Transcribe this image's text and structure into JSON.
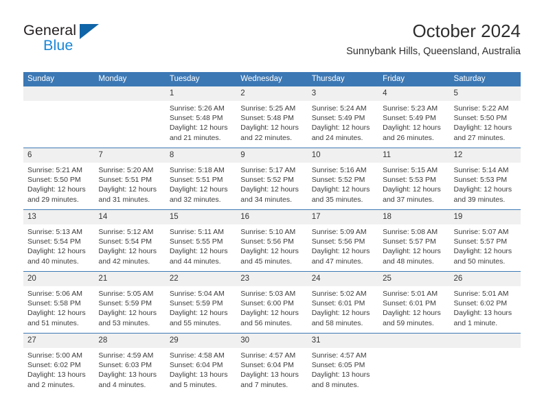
{
  "brand": {
    "name_part1": "General",
    "name_part2": "Blue",
    "triangle_color": "#1064a8",
    "blue_text_color": "#1787d8"
  },
  "header": {
    "title": "October 2024",
    "subtitle": "Sunnybank Hills, Queensland, Australia"
  },
  "theme": {
    "header_blue": "#3c78b4",
    "day_number_bg": "#f0f0f0",
    "cell_bg": "#ffffff"
  },
  "weekdays": [
    "Sunday",
    "Monday",
    "Tuesday",
    "Wednesday",
    "Thursday",
    "Friday",
    "Saturday"
  ],
  "weeks": [
    [
      {
        "day": "",
        "sunrise": "",
        "sunset": "",
        "daylight_line1": "",
        "daylight_line2": ""
      },
      {
        "day": "",
        "sunrise": "",
        "sunset": "",
        "daylight_line1": "",
        "daylight_line2": ""
      },
      {
        "day": "1",
        "sunrise": "Sunrise: 5:26 AM",
        "sunset": "Sunset: 5:48 PM",
        "daylight_line1": "Daylight: 12 hours",
        "daylight_line2": "and 21 minutes."
      },
      {
        "day": "2",
        "sunrise": "Sunrise: 5:25 AM",
        "sunset": "Sunset: 5:48 PM",
        "daylight_line1": "Daylight: 12 hours",
        "daylight_line2": "and 22 minutes."
      },
      {
        "day": "3",
        "sunrise": "Sunrise: 5:24 AM",
        "sunset": "Sunset: 5:49 PM",
        "daylight_line1": "Daylight: 12 hours",
        "daylight_line2": "and 24 minutes."
      },
      {
        "day": "4",
        "sunrise": "Sunrise: 5:23 AM",
        "sunset": "Sunset: 5:49 PM",
        "daylight_line1": "Daylight: 12 hours",
        "daylight_line2": "and 26 minutes."
      },
      {
        "day": "5",
        "sunrise": "Sunrise: 5:22 AM",
        "sunset": "Sunset: 5:50 PM",
        "daylight_line1": "Daylight: 12 hours",
        "daylight_line2": "and 27 minutes."
      }
    ],
    [
      {
        "day": "6",
        "sunrise": "Sunrise: 5:21 AM",
        "sunset": "Sunset: 5:50 PM",
        "daylight_line1": "Daylight: 12 hours",
        "daylight_line2": "and 29 minutes."
      },
      {
        "day": "7",
        "sunrise": "Sunrise: 5:20 AM",
        "sunset": "Sunset: 5:51 PM",
        "daylight_line1": "Daylight: 12 hours",
        "daylight_line2": "and 31 minutes."
      },
      {
        "day": "8",
        "sunrise": "Sunrise: 5:18 AM",
        "sunset": "Sunset: 5:51 PM",
        "daylight_line1": "Daylight: 12 hours",
        "daylight_line2": "and 32 minutes."
      },
      {
        "day": "9",
        "sunrise": "Sunrise: 5:17 AM",
        "sunset": "Sunset: 5:52 PM",
        "daylight_line1": "Daylight: 12 hours",
        "daylight_line2": "and 34 minutes."
      },
      {
        "day": "10",
        "sunrise": "Sunrise: 5:16 AM",
        "sunset": "Sunset: 5:52 PM",
        "daylight_line1": "Daylight: 12 hours",
        "daylight_line2": "and 35 minutes."
      },
      {
        "day": "11",
        "sunrise": "Sunrise: 5:15 AM",
        "sunset": "Sunset: 5:53 PM",
        "daylight_line1": "Daylight: 12 hours",
        "daylight_line2": "and 37 minutes."
      },
      {
        "day": "12",
        "sunrise": "Sunrise: 5:14 AM",
        "sunset": "Sunset: 5:53 PM",
        "daylight_line1": "Daylight: 12 hours",
        "daylight_line2": "and 39 minutes."
      }
    ],
    [
      {
        "day": "13",
        "sunrise": "Sunrise: 5:13 AM",
        "sunset": "Sunset: 5:54 PM",
        "daylight_line1": "Daylight: 12 hours",
        "daylight_line2": "and 40 minutes."
      },
      {
        "day": "14",
        "sunrise": "Sunrise: 5:12 AM",
        "sunset": "Sunset: 5:54 PM",
        "daylight_line1": "Daylight: 12 hours",
        "daylight_line2": "and 42 minutes."
      },
      {
        "day": "15",
        "sunrise": "Sunrise: 5:11 AM",
        "sunset": "Sunset: 5:55 PM",
        "daylight_line1": "Daylight: 12 hours",
        "daylight_line2": "and 44 minutes."
      },
      {
        "day": "16",
        "sunrise": "Sunrise: 5:10 AM",
        "sunset": "Sunset: 5:56 PM",
        "daylight_line1": "Daylight: 12 hours",
        "daylight_line2": "and 45 minutes."
      },
      {
        "day": "17",
        "sunrise": "Sunrise: 5:09 AM",
        "sunset": "Sunset: 5:56 PM",
        "daylight_line1": "Daylight: 12 hours",
        "daylight_line2": "and 47 minutes."
      },
      {
        "day": "18",
        "sunrise": "Sunrise: 5:08 AM",
        "sunset": "Sunset: 5:57 PM",
        "daylight_line1": "Daylight: 12 hours",
        "daylight_line2": "and 48 minutes."
      },
      {
        "day": "19",
        "sunrise": "Sunrise: 5:07 AM",
        "sunset": "Sunset: 5:57 PM",
        "daylight_line1": "Daylight: 12 hours",
        "daylight_line2": "and 50 minutes."
      }
    ],
    [
      {
        "day": "20",
        "sunrise": "Sunrise: 5:06 AM",
        "sunset": "Sunset: 5:58 PM",
        "daylight_line1": "Daylight: 12 hours",
        "daylight_line2": "and 51 minutes."
      },
      {
        "day": "21",
        "sunrise": "Sunrise: 5:05 AM",
        "sunset": "Sunset: 5:59 PM",
        "daylight_line1": "Daylight: 12 hours",
        "daylight_line2": "and 53 minutes."
      },
      {
        "day": "22",
        "sunrise": "Sunrise: 5:04 AM",
        "sunset": "Sunset: 5:59 PM",
        "daylight_line1": "Daylight: 12 hours",
        "daylight_line2": "and 55 minutes."
      },
      {
        "day": "23",
        "sunrise": "Sunrise: 5:03 AM",
        "sunset": "Sunset: 6:00 PM",
        "daylight_line1": "Daylight: 12 hours",
        "daylight_line2": "and 56 minutes."
      },
      {
        "day": "24",
        "sunrise": "Sunrise: 5:02 AM",
        "sunset": "Sunset: 6:01 PM",
        "daylight_line1": "Daylight: 12 hours",
        "daylight_line2": "and 58 minutes."
      },
      {
        "day": "25",
        "sunrise": "Sunrise: 5:01 AM",
        "sunset": "Sunset: 6:01 PM",
        "daylight_line1": "Daylight: 12 hours",
        "daylight_line2": "and 59 minutes."
      },
      {
        "day": "26",
        "sunrise": "Sunrise: 5:01 AM",
        "sunset": "Sunset: 6:02 PM",
        "daylight_line1": "Daylight: 13 hours",
        "daylight_line2": "and 1 minute."
      }
    ],
    [
      {
        "day": "27",
        "sunrise": "Sunrise: 5:00 AM",
        "sunset": "Sunset: 6:02 PM",
        "daylight_line1": "Daylight: 13 hours",
        "daylight_line2": "and 2 minutes."
      },
      {
        "day": "28",
        "sunrise": "Sunrise: 4:59 AM",
        "sunset": "Sunset: 6:03 PM",
        "daylight_line1": "Daylight: 13 hours",
        "daylight_line2": "and 4 minutes."
      },
      {
        "day": "29",
        "sunrise": "Sunrise: 4:58 AM",
        "sunset": "Sunset: 6:04 PM",
        "daylight_line1": "Daylight: 13 hours",
        "daylight_line2": "and 5 minutes."
      },
      {
        "day": "30",
        "sunrise": "Sunrise: 4:57 AM",
        "sunset": "Sunset: 6:04 PM",
        "daylight_line1": "Daylight: 13 hours",
        "daylight_line2": "and 7 minutes."
      },
      {
        "day": "31",
        "sunrise": "Sunrise: 4:57 AM",
        "sunset": "Sunset: 6:05 PM",
        "daylight_line1": "Daylight: 13 hours",
        "daylight_line2": "and 8 minutes."
      },
      {
        "day": "",
        "sunrise": "",
        "sunset": "",
        "daylight_line1": "",
        "daylight_line2": ""
      },
      {
        "day": "",
        "sunrise": "",
        "sunset": "",
        "daylight_line1": "",
        "daylight_line2": ""
      }
    ]
  ]
}
